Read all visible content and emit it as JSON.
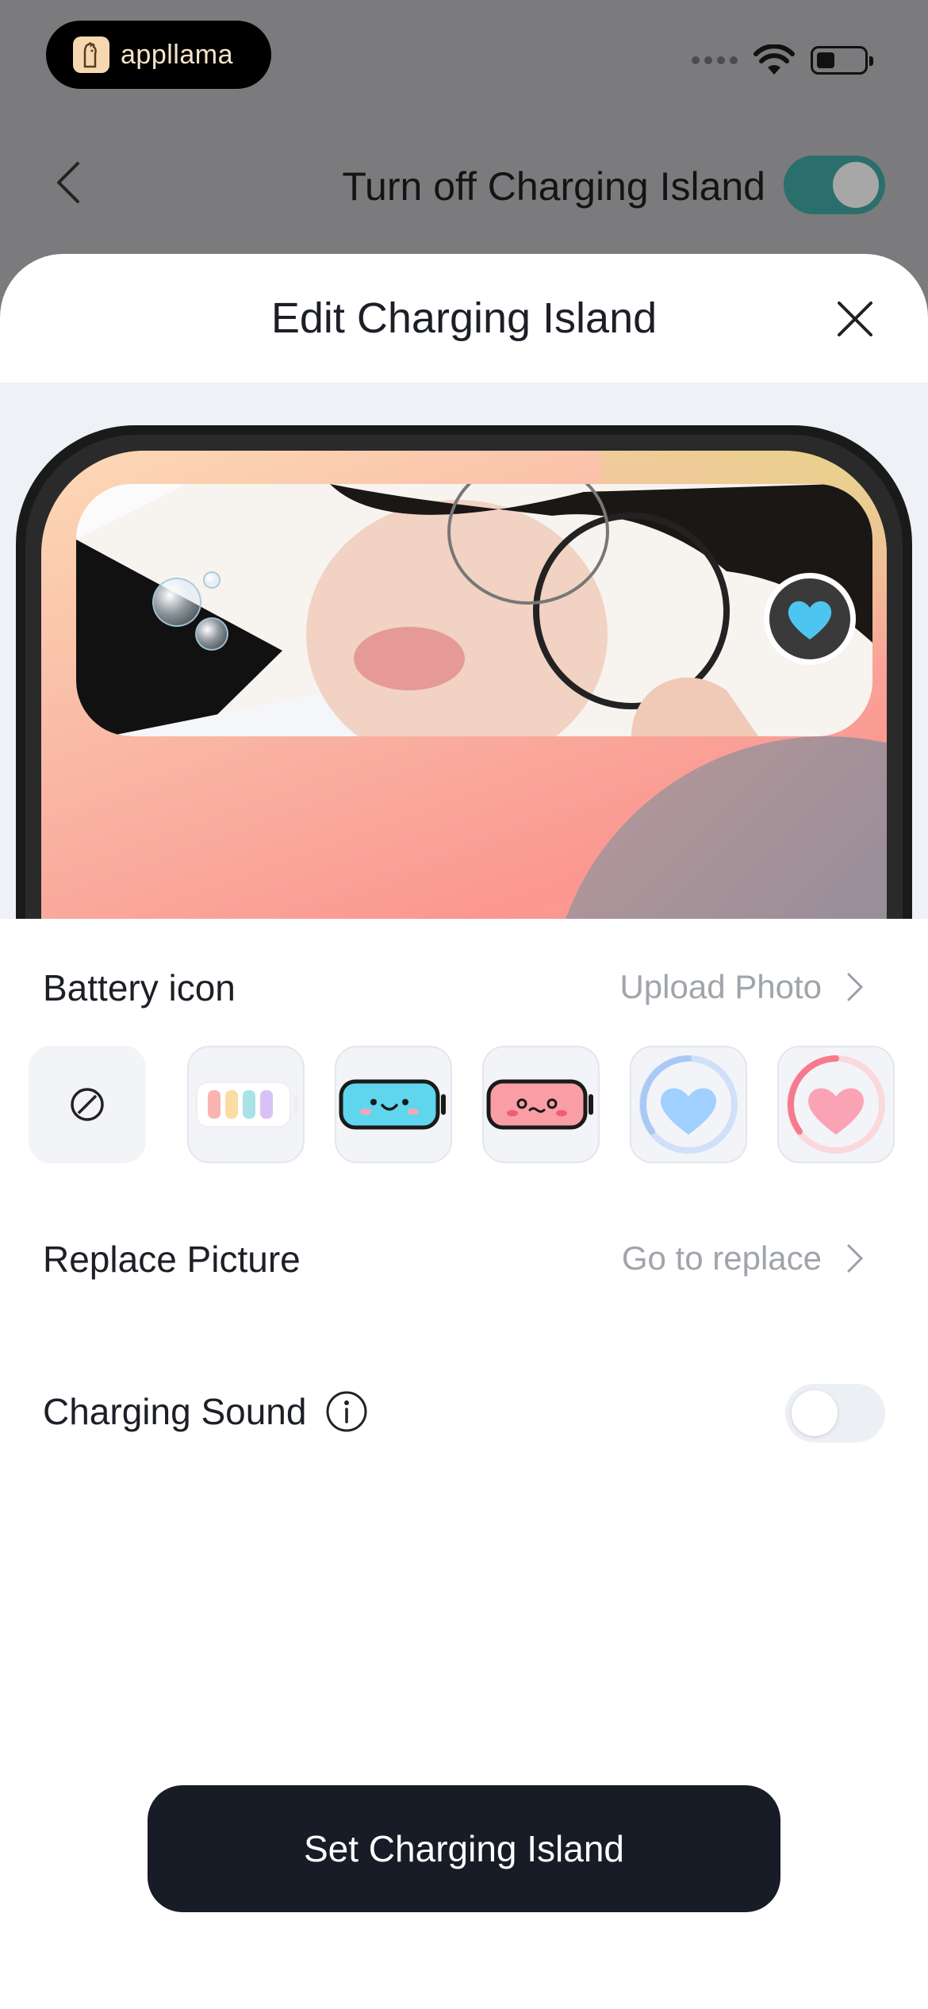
{
  "status_bar": {
    "brand_name": "appllama",
    "brand_colors": {
      "pill": "#000000",
      "text": "#f7e3c8"
    },
    "icons": [
      "cellular-signal-icon",
      "wifi-icon",
      "battery-icon"
    ]
  },
  "header": {
    "turn_off_label": "Turn off Charging Island",
    "turn_off_enabled": true,
    "accent_color": "#2a6f6b"
  },
  "sheet": {
    "title": "Edit Charging Island",
    "battery_icon_section": {
      "label": "Battery icon",
      "action_label": "Upload Photo",
      "options": [
        {
          "name": "none-option",
          "icon": "prohibited-icon"
        },
        {
          "name": "pastel-battery-option",
          "icon": "pastel-bars-battery-icon"
        },
        {
          "name": "smiling-blue-battery-option",
          "icon": "smiling-blue-battery-icon"
        },
        {
          "name": "cute-pink-battery-option",
          "icon": "cute-pink-battery-icon"
        },
        {
          "name": "blue-heart-ring-option",
          "icon": "blue-heart-ring-icon"
        },
        {
          "name": "pink-heart-ring-option",
          "icon": "pink-heart-ring-icon"
        }
      ]
    },
    "replace_picture": {
      "label": "Replace Picture",
      "action_label": "Go to replace"
    },
    "charging_sound": {
      "label": "Charging Sound",
      "enabled": false
    },
    "primary_button_label": "Set Charging Island"
  }
}
